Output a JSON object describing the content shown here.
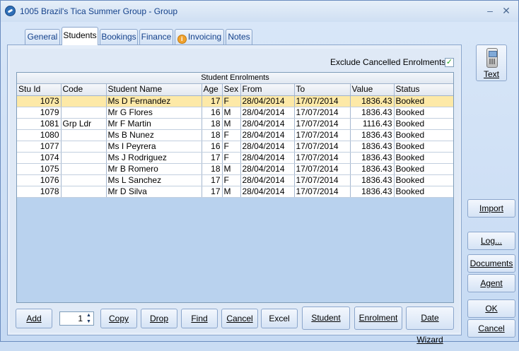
{
  "window": {
    "title": "1005 Brazil's Tica Summer Group - Group",
    "minimize_glyph": "–",
    "close_glyph": "✕"
  },
  "tabs": [
    {
      "label": "General"
    },
    {
      "label": "Students"
    },
    {
      "label": "Bookings"
    },
    {
      "label": "Finance"
    },
    {
      "label": "Invoicing",
      "icon": "info-icon",
      "icon_glyph": "i"
    },
    {
      "label": "Notes"
    }
  ],
  "active_tab": "Students",
  "filter": {
    "exclude_label": "Exclude Cancelled Enrolments",
    "checked": true,
    "check_glyph": "✓"
  },
  "grid": {
    "caption": "Student Enrolments",
    "columns": [
      "Stu Id",
      "Code",
      "Student Name",
      "Age",
      "Sex",
      "From",
      "To",
      "Value",
      "Status"
    ],
    "rows": [
      [
        "1073",
        "",
        "Ms D Fernandez",
        "17",
        "F",
        "28/04/2014",
        "17/07/2014",
        "1836.43",
        "Booked"
      ],
      [
        "1079",
        "",
        "Mr G Flores",
        "16",
        "M",
        "28/04/2014",
        "17/07/2014",
        "1836.43",
        "Booked"
      ],
      [
        "1081",
        "Grp Ldr",
        "Mr F Martin",
        "18",
        "M",
        "28/04/2014",
        "17/07/2014",
        "1116.43",
        "Booked"
      ],
      [
        "1080",
        "",
        "Ms B Nunez",
        "18",
        "F",
        "28/04/2014",
        "17/07/2014",
        "1836.43",
        "Booked"
      ],
      [
        "1077",
        "",
        "Ms I Peyrera",
        "16",
        "F",
        "28/04/2014",
        "17/07/2014",
        "1836.43",
        "Booked"
      ],
      [
        "1074",
        "",
        "Ms J Rodriguez",
        "17",
        "F",
        "28/04/2014",
        "17/07/2014",
        "1836.43",
        "Booked"
      ],
      [
        "1075",
        "",
        "Mr B Romero",
        "18",
        "M",
        "28/04/2014",
        "17/07/2014",
        "1836.43",
        "Booked"
      ],
      [
        "1076",
        "",
        "Ms L Sanchez",
        "17",
        "F",
        "28/04/2014",
        "17/07/2014",
        "1836.43",
        "Booked"
      ],
      [
        "1078",
        "",
        "Mr D Silva",
        "17",
        "M",
        "28/04/2014",
        "17/07/2014",
        "1836.43",
        "Booked"
      ]
    ],
    "selected_row": 0
  },
  "bottom_buttons": {
    "add": "Add",
    "quantity": "1",
    "copy": "Copy",
    "drop": "Drop",
    "find": "Find",
    "cancel": "Cancel",
    "excel": "Excel",
    "student": "Student",
    "enrolment": "Enrolment",
    "date_wizard": "Date Wizard"
  },
  "side_buttons": {
    "text": "Text",
    "import": "Import",
    "log": "Log...",
    "documents": "Documents",
    "agent": "Agent",
    "ok": "OK",
    "cancel": "Cancel"
  },
  "colors": {
    "selected_row": "#fde9a7",
    "grid_background": "#b9d2ee",
    "title_text": "#15428b"
  }
}
